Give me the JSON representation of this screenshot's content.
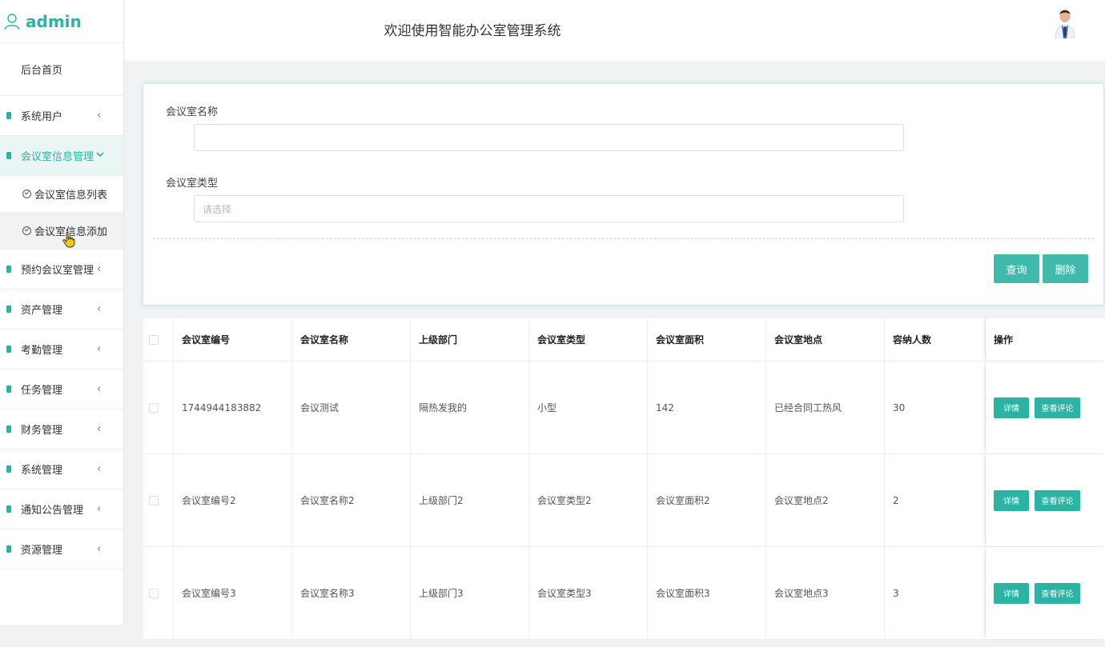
{
  "sidebar": {
    "brand": "admin",
    "home": "后台首页",
    "items": [
      {
        "label": "系统用户",
        "chevron": "‹"
      },
      {
        "label": "会议室信息管理",
        "chevron": "⌄"
      },
      {
        "label": "预约会议室管理",
        "chevron": "‹"
      },
      {
        "label": "资产管理",
        "chevron": "‹"
      },
      {
        "label": "考勤管理",
        "chevron": "‹"
      },
      {
        "label": "任务管理",
        "chevron": "‹"
      },
      {
        "label": "财务管理",
        "chevron": "‹"
      },
      {
        "label": "系统管理",
        "chevron": "‹"
      },
      {
        "label": "通知公告管理",
        "chevron": "‹"
      },
      {
        "label": "资源管理",
        "chevron": "‹"
      }
    ],
    "subitems": [
      {
        "label": "会议室信息列表"
      },
      {
        "label": "会议室信息添加"
      }
    ]
  },
  "header": {
    "title": "欢迎使用智能办公室管理系统"
  },
  "search": {
    "name_label": "会议室名称",
    "name_value": "",
    "type_label": "会议室类型",
    "type_placeholder": "请选择",
    "query_button": "查询",
    "delete_button": "删除"
  },
  "table": {
    "headers": [
      "会议室编号",
      "会议室名称",
      "上级部门",
      "会议室类型",
      "会议室面积",
      "会议室地点",
      "容纳人数",
      "操作"
    ],
    "rows": [
      {
        "cells": [
          "1744944183882",
          "会议测试",
          "隔热发我的",
          "小型",
          "142",
          "已经合同工热风",
          "30"
        ]
      },
      {
        "cells": [
          "会议室编号2",
          "会议室名称2",
          "上级部门2",
          "会议室类型2",
          "会议室面积2",
          "会议室地点2",
          "2"
        ]
      },
      {
        "cells": [
          "会议室编号3",
          "会议室名称3",
          "上级部门3",
          "会议室类型3",
          "会议室面积3",
          "会议室地点3",
          "3"
        ]
      }
    ],
    "detail_button": "详情",
    "comment_button": "查看评论"
  },
  "colors": {
    "accent": "#2bb3a3"
  }
}
